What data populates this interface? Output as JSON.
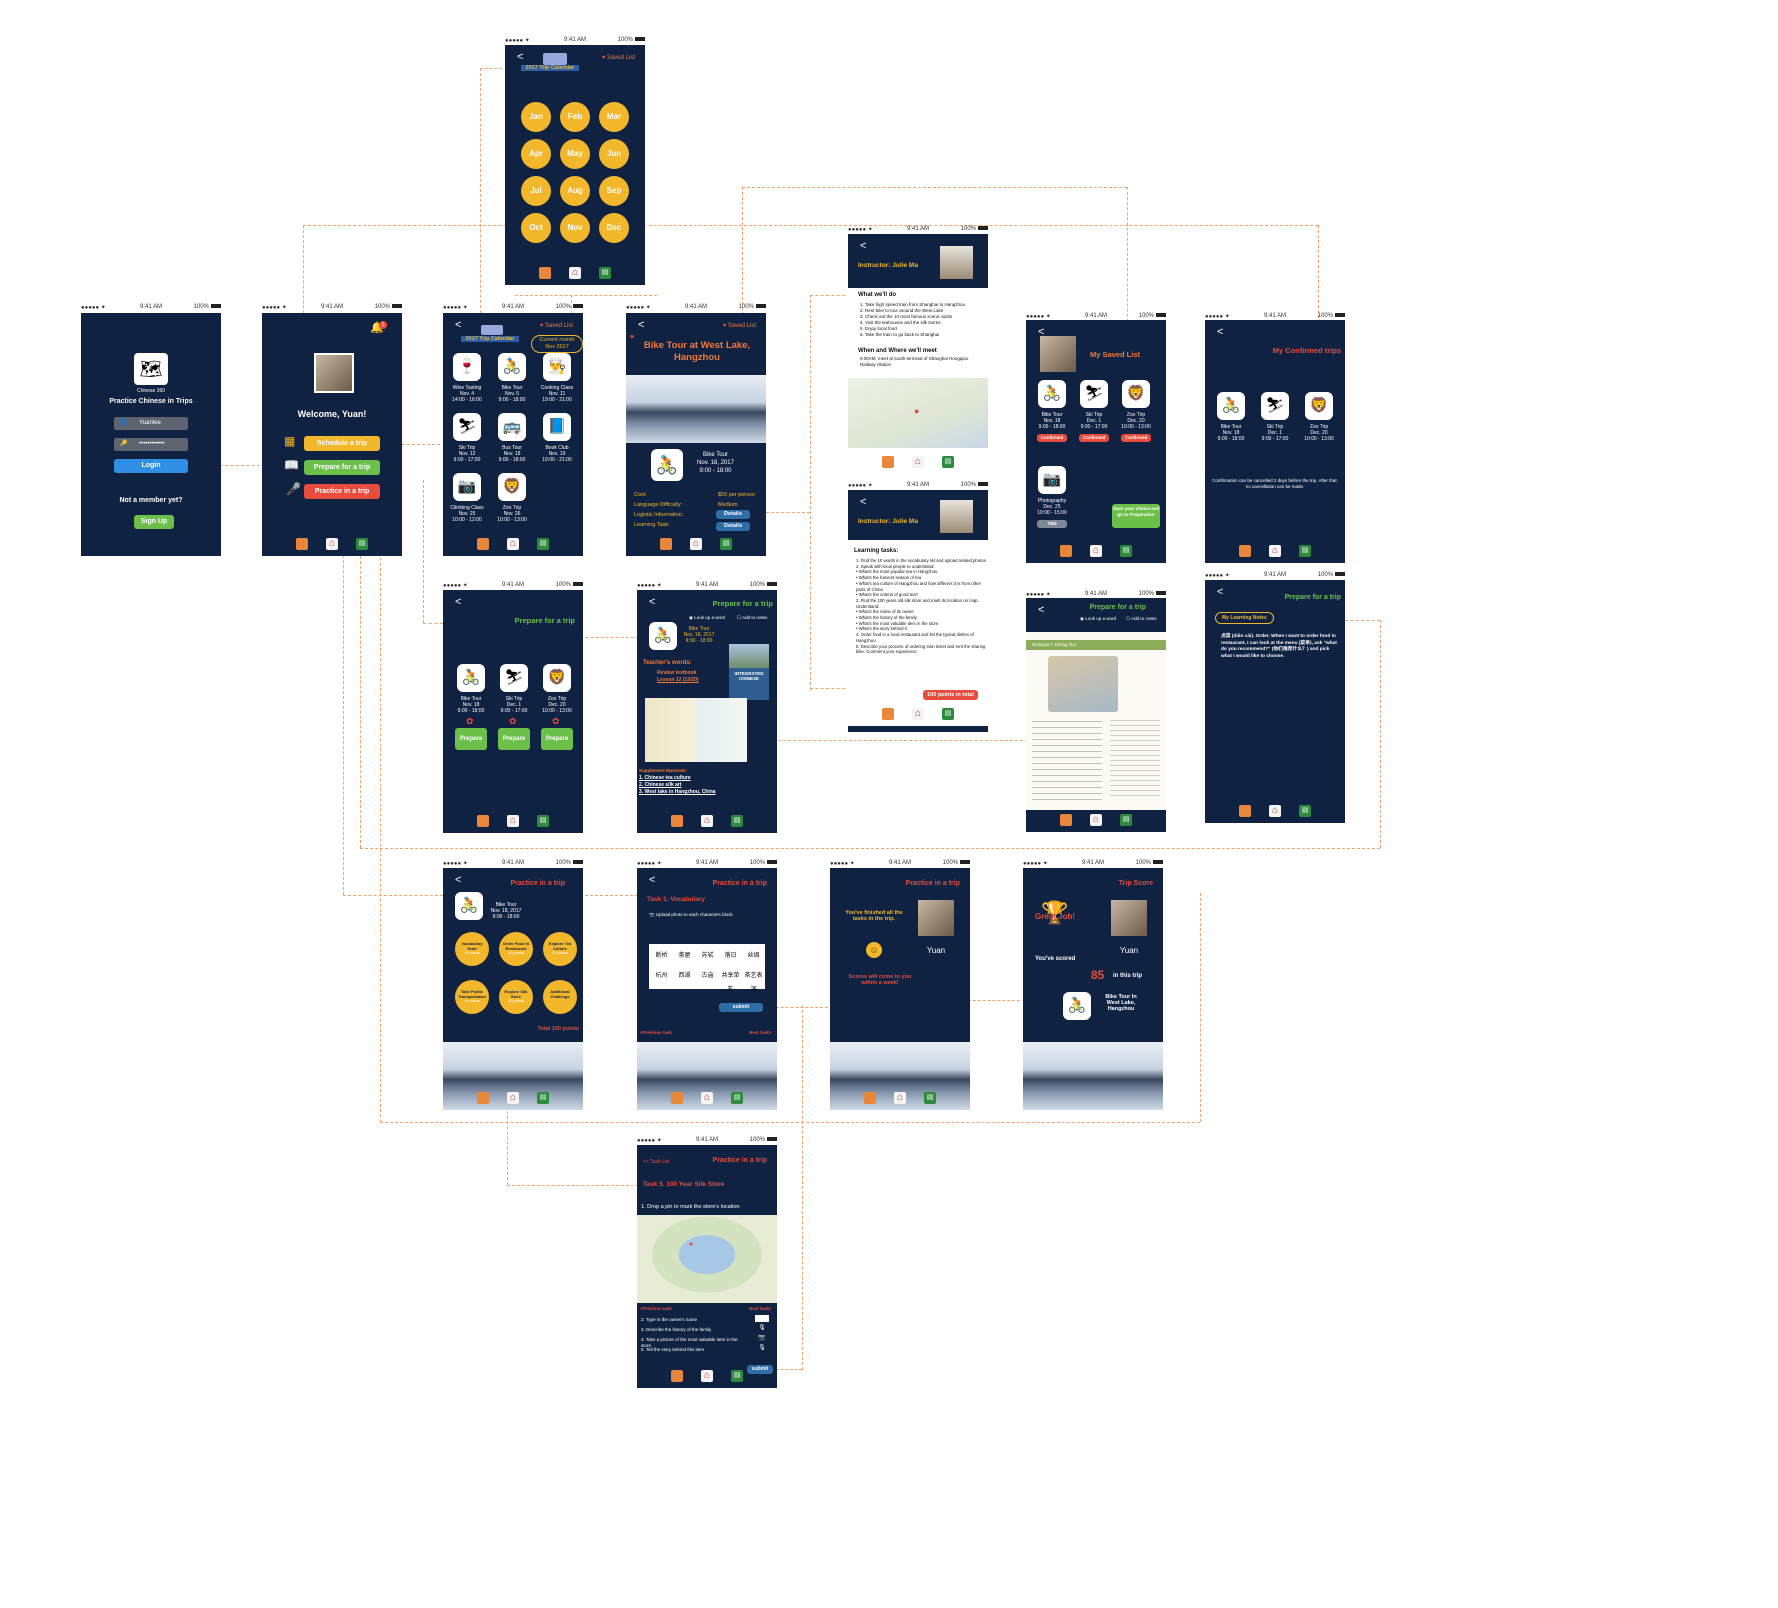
{
  "status": {
    "carrier": "●●●●● ✦",
    "time": "9:41 AM",
    "battery": "100%"
  },
  "login": {
    "app_name": "Chinese 360",
    "title": "Practice Chinese in Trips",
    "username": "Yuanlee",
    "password": "••••••••••••",
    "login_btn": "Login",
    "not_member": "Not a member yet?",
    "signup_btn": "Sign Up"
  },
  "welcome": {
    "badge": "1",
    "greeting": "Welcome, Yuan!",
    "schedule_btn": "Schedule a trip",
    "prepare_btn": "Prepare for a trip",
    "practice_btn": "Practice in a trip"
  },
  "calendar": {
    "title": "2017 Trip Calendar",
    "saved": "Saved List",
    "months": [
      "Jan",
      "Feb",
      "Mar",
      "Apr",
      "May",
      "Jun",
      "Jul",
      "Aug",
      "Sep",
      "Oct",
      "Nov",
      "Dec"
    ]
  },
  "trips": {
    "title": "2017 Trip Calendar",
    "saved": "Saved List",
    "current": "Current month\nNov 2017",
    "items": [
      {
        "name": "Wine Tasting",
        "date": "Nov. 4",
        "time": "14:00 - 16:00",
        "icon": "🍷"
      },
      {
        "name": "Bike Tour",
        "date": "Nov. 5",
        "time": "9:00 - 18:00",
        "icon": "🚴"
      },
      {
        "name": "Cooking Class",
        "date": "Nov. 11",
        "time": "19:00 - 21:00",
        "icon": "👨‍🍳"
      },
      {
        "name": "Ski Trip",
        "date": "Nov. 12",
        "time": "9:00 - 17:00",
        "icon": "⛷"
      },
      {
        "name": "Bus Tour",
        "date": "Nov. 18",
        "time": "9:00 - 18:00",
        "icon": "🚌"
      },
      {
        "name": "Book Club",
        "date": "Nov. 19",
        "time": "19:00 - 21:00",
        "icon": "📘"
      },
      {
        "name": "Climbing Class",
        "date": "Nov. 25",
        "time": "10:00 - 12:00",
        "icon": "📷"
      },
      {
        "name": "Zoo Trip",
        "date": "Nov. 26",
        "time": "10:00 - 13:00",
        "icon": "🦁"
      }
    ]
  },
  "bike": {
    "saved": "Saved List",
    "title": "Bike Tour at West Lake, Hangzhou",
    "sub1": "Bike Tour",
    "sub2": "Nov. 18, 2017",
    "sub3": "9:00 - 18:00",
    "cost_label": "Cost:",
    "cost": "$50 per person",
    "lang_label": "Language Difficulty:",
    "lang": "Medium",
    "logistic_label": "Logistic Information:",
    "task_label": "Learning Task:",
    "details": "Details"
  },
  "instructor1": {
    "name": "Instructor: Julie Ma",
    "what_title": "What we'll do",
    "what_items": [
      "1.  Take high speed train from Shanghai to Hangzhou",
      "2.  Rent bike to tour around the West Lake",
      "3.  Check out the 10 most famous scenic spots",
      "4.  Visit the teahouses and the silk stores",
      "5.  Enjoy local food",
      "6.  Take the train to go back to Shanghai"
    ],
    "where_title": "When and Where we'll meet",
    "where_text": "9:00AM, meet at south terminal of Shanghai Hongqiao Railway Station"
  },
  "instructor2": {
    "name": "Instructor: Julie Ma",
    "tasks_title": "Learning tasks:",
    "tasks": [
      "1.  Find the 10 words in the vocabulary list and upload related photos",
      "2.  Speak with local people to understand:",
      "  •  What's the most popular tea in Hangzhou",
      "  •  What's the harvest season of tea",
      "  •  What's tea culture of Hangzhou and how different it is from other parts of China",
      "  •  What's the criteria of good tea?",
      "3.  Find the 100 years old silk store and mark its location on map. Understand:",
      "  •  What's the name of its owner",
      "  •  What's the history of the family",
      "  •  What's the most valuable item in the store",
      "  •  What's the story behind it",
      "4.  Order food in a local restaurant and list the typical dishes of Hangzhou",
      "5.  Describe your process of ordering train ticket and rent the sharing bike. Comment your experience"
    ],
    "points": "100  points in total"
  },
  "savedlist": {
    "title": "My Saved List",
    "items": [
      {
        "name": "Bike Tour",
        "date": "Nov. 18",
        "time": "9:00 - 18:00",
        "icon": "🚴",
        "status": "Confirmed"
      },
      {
        "name": "Ski Trip",
        "date": "Dec. 1",
        "time": "9:00 - 17:00",
        "icon": "⛷",
        "status": "Confirmed"
      },
      {
        "name": "Zoo Trip",
        "date": "Dec. 20",
        "time": "10:00 - 13:00",
        "icon": "🦁",
        "status": "Confirmed"
      },
      {
        "name": "Photography",
        "date": "Dec. 25",
        "time": "10:00 - 15:00",
        "icon": "📷",
        "status": "TBD"
      }
    ],
    "save_btn": "Save your choice and go to Preparation"
  },
  "confirmed": {
    "title": "My Confirmed trips",
    "items": [
      {
        "name": "Bike Tour",
        "date": "Nov. 18",
        "time": "9:00 - 18:00",
        "icon": "🚴"
      },
      {
        "name": "Ski Trip",
        "date": "Dec. 1",
        "time": "9:00 - 17:00",
        "icon": "⛷"
      },
      {
        "name": "Zoo Trip",
        "date": "Dec. 20",
        "time": "10:00 - 13:00",
        "icon": "🦁"
      }
    ],
    "note": "Confirmation can be cancelled 2 days before the trip. After that, no cancellation can be made."
  },
  "prepare": {
    "title": "Prepare for a trip",
    "items": [
      {
        "name": "Bike Tour",
        "date": "Nov. 18",
        "time": "9:00 - 18:00",
        "icon": "🚴"
      },
      {
        "name": "Ski Trip",
        "date": "Dec. 1",
        "time": "9:00 - 17:00",
        "icon": "⛷"
      },
      {
        "name": "Zoo Trip",
        "date": "Dec. 20",
        "time": "10:00 - 13:00",
        "icon": "🦁"
      }
    ],
    "btn": "Prepare"
  },
  "prepare2": {
    "title": "Prepare for a trip",
    "lookup": "Look up a word",
    "add_notes": "Add to notes",
    "trip": "Bike Tour",
    "date": "Nov. 18, 2017",
    "time": "9:00 - 18:00",
    "teachers_words": "Teacher's words:",
    "review": "Review textbook",
    "lesson": "Lesson 12 (13/20)",
    "book": "INTEGRATED CHINESE",
    "supp_title": "Supplement Materials:",
    "supp": [
      "1.  Chinese tea culture",
      "2.  Chinese silk art",
      "3.  West lake in Hangzhou, China"
    ]
  },
  "prepare3": {
    "title": "Prepare for a trip",
    "lookup": "Look up a word",
    "add_notes": "Add to notes",
    "section": "Dialogue I: Dining Out"
  },
  "notes": {
    "title": "Prepare for a trip",
    "label": "My Learning Notes",
    "text": "点菜 (diǎn cài). Order. When I want to order food in restaurant, I can look at the menu (菜单), ask \"what do you recommend?\" (你们推荐什么？) and pick what I would like to choose."
  },
  "practice1": {
    "title": "Practice in a trip",
    "trip": "Bike Tour",
    "date": "Nov. 18, 2017",
    "time": "9:00 - 18:00",
    "tasks": [
      {
        "name": "Vocabulary Hunt",
        "pts": "10 points"
      },
      {
        "name": "Order Food in Restaurant",
        "pts": "20 points"
      },
      {
        "name": "Explore Tea Culture",
        "pts": "20 points"
      },
      {
        "name": "Take Public Transportation",
        "pts": "10 points"
      },
      {
        "name": "Explore Silk Store",
        "pts": "20 points"
      },
      {
        "name": "Additional Challenge",
        "pts": ""
      }
    ],
    "total": "Total 100 points"
  },
  "practice2": {
    "title": "Practice in a trip",
    "task": "Task 1. Vocabulary",
    "upload": "Upload photo to each characters block",
    "words": [
      "断桥",
      "茶屋",
      "苏轼",
      "落日",
      "丝绸",
      "杭州",
      "西湖",
      "古庙",
      "共享单车",
      "茶艺表演"
    ],
    "submit": "submit",
    "prev": "<Previous task",
    "next": "Next task>"
  },
  "practice3": {
    "title": "Practice in a trip",
    "done": "You've finished all the tasks in the trip.",
    "name": "Yuan",
    "scores": "Scores will come to you within a week!"
  },
  "score": {
    "title": "Trip Score",
    "great": "Great Job!",
    "name": "Yuan",
    "scored": "You've scored",
    "value": "85",
    "suffix": "in this trip",
    "trip": "Bike Tour In West Lake, Hangzhou"
  },
  "task5": {
    "tasklist": "<< Task List",
    "title": "Practice in a trip",
    "task": "Task 5. 100 Year Silk Store",
    "step1": "1. Drop a pin to mark the store's location",
    "prev": "<Previous task",
    "next": "Next task>",
    "steps": [
      "2. Type in the owner's name",
      "3. Describe the history of the family",
      "4. Take a picture of the most valuable item in the store",
      "5. Tell the story behind this item"
    ],
    "submit": "submit"
  }
}
